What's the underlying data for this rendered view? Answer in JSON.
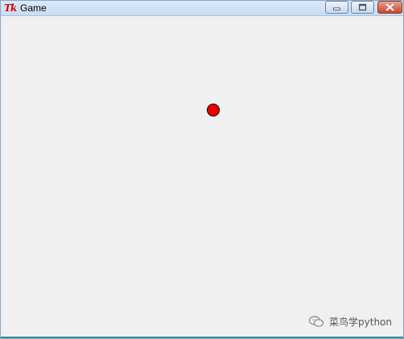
{
  "window": {
    "title": "Game",
    "icon": "tk-icon",
    "icon_text": "Tk",
    "controls": {
      "minimize_icon": "minimize-icon",
      "maximize_icon": "maximize-icon",
      "close_icon": "close-icon"
    }
  },
  "canvas": {
    "background": "#f0f0f0",
    "ball_color": "#ee0000",
    "ball_outline": "#000000"
  },
  "watermark": {
    "logo_icon": "wechat-logo-icon",
    "text": "菜鸟学python"
  }
}
